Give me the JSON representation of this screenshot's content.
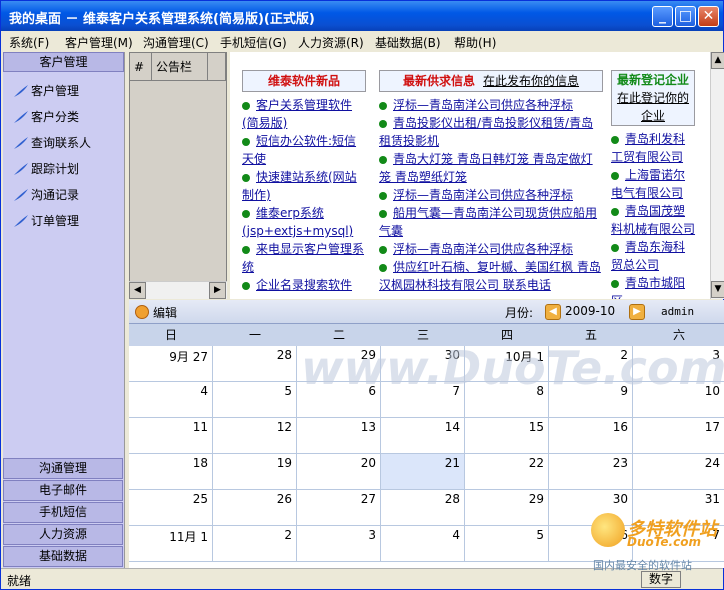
{
  "window": {
    "title": "我的桌面 － 维泰客户关系管理系统(简易版)(正式版)"
  },
  "menu": [
    "系统(F)",
    "客户管理(M)",
    "沟通管理(C)",
    "手机短信(G)",
    "人力资源(R)",
    "基础数据(B)",
    "帮助(H)"
  ],
  "nav": {
    "header": "客户管理",
    "items": [
      "客户管理",
      "客户分类",
      "查询联系人",
      "跟踪计划",
      "沟通记录",
      "订单管理"
    ],
    "bottom": [
      "沟通管理",
      "电子邮件",
      "手机短信",
      "人力资源",
      "基础数据"
    ]
  },
  "bulletin": {
    "col1": "#",
    "col2": "公告栏"
  },
  "news": {
    "col1": {
      "title": "维泰软件新品",
      "items": [
        "客户关系管理软件(简易版)",
        "短信办公软件:短信天使",
        "快速建站系统(网站制作)",
        "维泰erp系统(jsp+extjs+mysql)",
        "来电显示客户管理系统",
        "企业名录搜索软件"
      ]
    },
    "col2": {
      "title": "最新供求信息",
      "link": "在此发布你的信息",
      "items": [
        "浮标—青岛南洋公司供应各种浮标",
        "青岛投影仪出租/青岛投影仪租赁/青岛租赁投影机",
        "青岛大灯笼 青岛日韩灯笼 青岛定做灯笼 青岛塑纸灯笼",
        "浮标—青岛南洋公司供应各种浮标",
        "船用气囊—青岛南洋公司现货供应船用气囊",
        "浮标—青岛南洋公司供应各种浮标",
        "供应红叶石楠、复叶槭、美国红枫 青岛汉枫园林科技有限公司 联系电话"
      ]
    },
    "col3": {
      "title": "最新登记企业",
      "link": "在此登记你的企业",
      "items": [
        "青岛利发科工贸有限公司",
        "上海雷诺尔电气有限公司",
        "青岛国茂塑料机械有限公司",
        "青岛东海科贸总公司",
        "青岛市城阳区…"
      ]
    }
  },
  "toolbar": {
    "edit": "编辑",
    "month_label": "月份:",
    "month_value": "2009-10",
    "user": "admin"
  },
  "calendar": {
    "days": [
      "日",
      "一",
      "二",
      "三",
      "四",
      "五",
      "六"
    ],
    "rows": [
      [
        "9月 27",
        "28",
        "29",
        "30",
        "10月 1",
        "2",
        "3"
      ],
      [
        "4",
        "5",
        "6",
        "7",
        "8",
        "9",
        "10"
      ],
      [
        "11",
        "12",
        "13",
        "14",
        "15",
        "16",
        "17"
      ],
      [
        "18",
        "19",
        "20",
        "21",
        "22",
        "23",
        "24"
      ],
      [
        "25",
        "26",
        "27",
        "28",
        "29",
        "30",
        "31"
      ],
      [
        "11月 1",
        "2",
        "3",
        "4",
        "5",
        "6",
        "7"
      ]
    ],
    "today": "21"
  },
  "status": {
    "ready": "就绪",
    "num": "数字"
  },
  "watermark": {
    "text": "www.DuoTe.com",
    "brand": "多特软件站",
    "brand_en": "DuoTe.com",
    "sub": "国内最安全的软件站"
  }
}
